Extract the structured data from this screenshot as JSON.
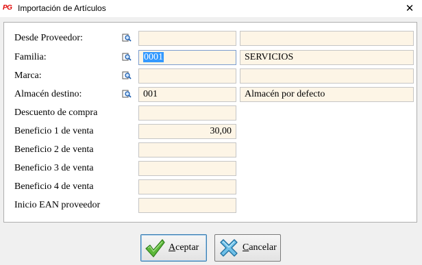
{
  "window": {
    "title": "Importación de Artículos",
    "app_icon": "PG",
    "close_glyph": "✕"
  },
  "form": {
    "proveedor": {
      "label": "Desde Proveedor:",
      "code": "",
      "desc": ""
    },
    "familia": {
      "label": "Familia:",
      "code": "0001",
      "desc": "SERVICIOS"
    },
    "marca": {
      "label": "Marca:",
      "code": "",
      "desc": ""
    },
    "almacen": {
      "label": "Almacén destino:",
      "code": "001",
      "desc": "Almacén por defecto"
    },
    "descuento": {
      "label": "Descuento de compra",
      "value": ""
    },
    "beneficio1": {
      "label": "Beneficio 1 de venta",
      "value": "30,00"
    },
    "beneficio2": {
      "label": "Beneficio 2 de venta",
      "value": ""
    },
    "beneficio3": {
      "label": "Beneficio 3 de venta",
      "value": ""
    },
    "beneficio4": {
      "label": "Beneficio 4 de venta",
      "value": ""
    },
    "ean": {
      "label": "Inicio EAN proveedor",
      "value": ""
    }
  },
  "buttons": {
    "accept": {
      "access_key": "A",
      "rest": "ceptar"
    },
    "cancel": {
      "access_key": "C",
      "rest": "ancelar"
    }
  },
  "icons": {
    "lookup": "magnifier-lookup-icon",
    "accept": "green-check-icon",
    "cancel": "blue-x-icon"
  }
}
